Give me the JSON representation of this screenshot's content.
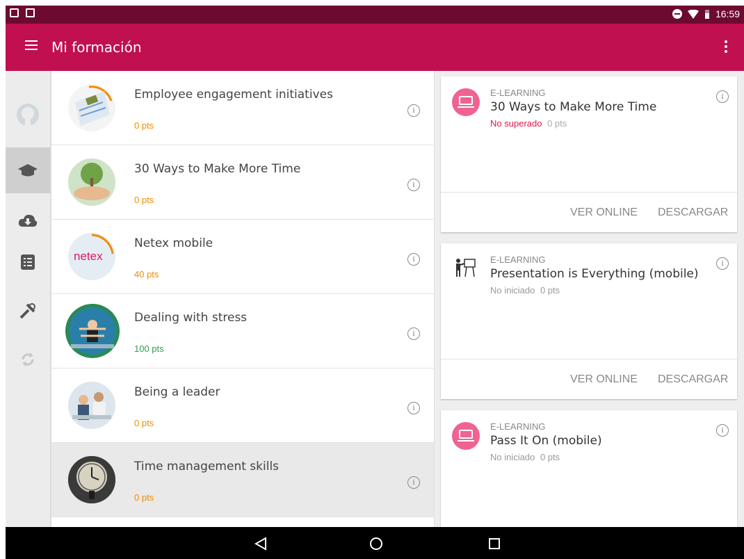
{
  "status_bar": {
    "time": "16:59"
  },
  "app_bar": {
    "title": "Mi formación"
  },
  "nav_rail": {
    "items": [
      "profile-icon",
      "graduation-cap-icon",
      "cloud-download-icon",
      "list-icon",
      "tools-icon",
      "sync-icon"
    ]
  },
  "courses": [
    {
      "title": "Employee engagement initiatives",
      "points": "0 pts",
      "points_color": "#ef8c00"
    },
    {
      "title": "30 Ways to Make More Time",
      "points": "0 pts",
      "points_color": "#ef8c00"
    },
    {
      "title": "Netex mobile",
      "points": "40 pts",
      "points_color": "#ef8c00",
      "logo_text": "netex"
    },
    {
      "title": "Dealing with stress",
      "points": "100 pts",
      "points_color": "#2e9e4f"
    },
    {
      "title": "Being a leader",
      "points": "0 pts",
      "points_color": "#ef8c00"
    },
    {
      "title": "Time management skills",
      "points": "0 pts",
      "points_color": "#ef8c00"
    }
  ],
  "cards": [
    {
      "type": "E-LEARNING",
      "title": "30 Ways to Make More Time",
      "status": "No superado",
      "status_color": "#e0184f",
      "points": "0 pts",
      "view_label": "VER ONLINE",
      "download_label": "DESCARGAR"
    },
    {
      "type": "E-LEARNING",
      "title": "Presentation is Everything (mobile)",
      "status": "No iniciado",
      "status_color": "#999999",
      "points": "0 pts",
      "view_label": "VER ONLINE",
      "download_label": "DESCARGAR"
    },
    {
      "type": "E-LEARNING",
      "title": "Pass It On (mobile)",
      "status": "No iniciado",
      "status_color": "#999999",
      "points": "0 pts"
    }
  ],
  "colors": {
    "status_bar": "#6d0a2f",
    "app_bar": "#c0104f",
    "accent_pink": "#f06292"
  }
}
